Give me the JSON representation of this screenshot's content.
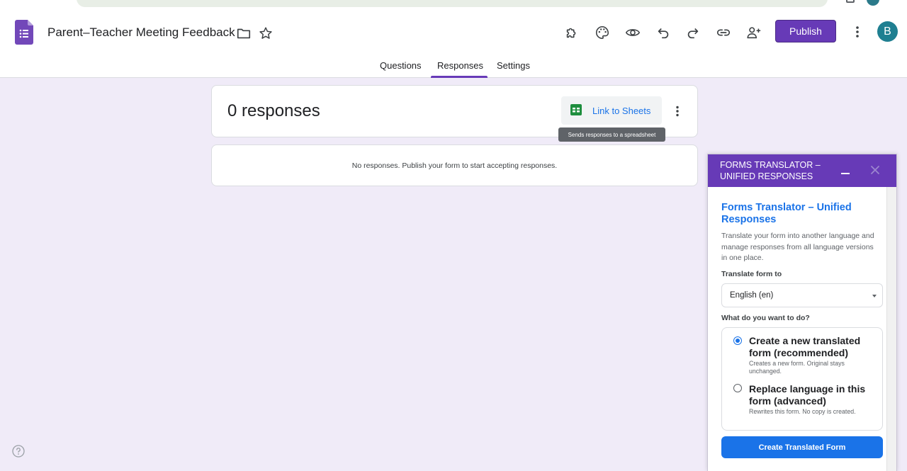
{
  "form": {
    "title": "Parent–Teacher Meeting Feedback"
  },
  "header": {
    "publish_label": "Publish",
    "avatar_letter": "B"
  },
  "tabs": [
    {
      "label": "Questions"
    },
    {
      "label": "Responses"
    },
    {
      "label": "Settings"
    }
  ],
  "responses": {
    "count_label": "0 responses",
    "link_sheets_label": "Link to Sheets",
    "tooltip": "Sends responses to a spreadsheet",
    "empty_message": "No responses. Publish your form to start accepting responses."
  },
  "translator": {
    "panel_title": "Forms Translator – Unified Responses",
    "heading": "Forms Translator – Unified Responses",
    "description": "Translate your form into another language and manage responses from all language versions in one place.",
    "translate_label": "Translate form to",
    "language_value": "English (en)",
    "action_label": "What do you want to do?",
    "options": [
      {
        "title": "Create a new translated form (recommended)",
        "subtitle": "Creates a new form. Original stays unchanged.",
        "selected": true
      },
      {
        "title": "Replace language in this form (advanced)",
        "subtitle": "Rewrites this form. No copy is created.",
        "selected": false
      }
    ],
    "button_label": "Create Translated Form"
  },
  "colors": {
    "brand": "#673ab7",
    "accent": "#1a73e8",
    "background": "#f0ebf8"
  }
}
